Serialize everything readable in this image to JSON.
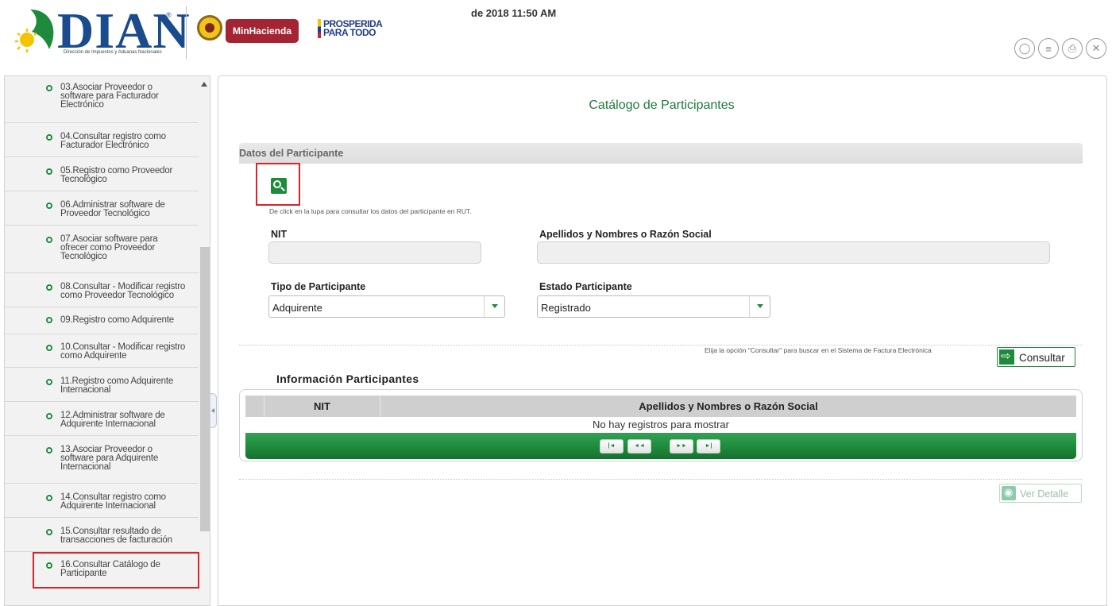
{
  "header": {
    "logo_text": "DIAN",
    "logo_registered": "®",
    "logo_subtitle": "Dirección de Impuestos y Aduanas Nacionales",
    "ministry_badge": "MinHacienda",
    "slogan_line1": "PROSPERIDA",
    "slogan_line2": "PARA TODO",
    "datetime": "de 2018 11:50 AM",
    "tool_icons": [
      "shield-icon",
      "list-icon",
      "printer-icon",
      "close-circle-icon"
    ],
    "colors": {
      "brand_blue": "#1a4b8c",
      "ministry_red": "#a42434"
    }
  },
  "sidebar": {
    "items": [
      {
        "label": "03.Asociar Proveedor o\nsoftware para Facturador\nElectrónico"
      },
      {
        "label": "04.Consultar registro como\nFacturador Electrónico"
      },
      {
        "label": "05.Registro como Proveedor\nTecnológico"
      },
      {
        "label": "06.Administrar software de\nProveedor Tecnológico"
      },
      {
        "label": "07.Asociar software para\nofrecer como Proveedor\nTecnológico"
      },
      {
        "label": "08.Consultar - Modificar registro\ncomo Proveedor Tecnológico"
      },
      {
        "label": "09.Registro como Adquirente"
      },
      {
        "label": "10.Consultar - Modificar registro\ncomo Adquirente"
      },
      {
        "label": "11.Registro como Adquirente\nInternacional"
      },
      {
        "label": "12.Administrar software de\nAdquirente Internacional"
      },
      {
        "label": "13.Asociar Proveedor o\nsoftware para Adquirente\nInternacional"
      },
      {
        "label": "14.Consultar registro como\nAdquirente Internacional"
      },
      {
        "label": "15.Consultar resultado de\ntransacciones de facturación"
      },
      {
        "label": "16.Consultar Catálogo de\nParticipante"
      }
    ],
    "selected_item": "16.Consultar Catálogo de Participante"
  },
  "main": {
    "title": "Catálogo de Participantes",
    "section_title": "Datos del Participante",
    "search_hint": "De click en la lupa para consultar los datos del participante en RUT.",
    "fields": {
      "nit_label": "NIT",
      "nit_value": "",
      "name_label": "Apellidos y Nombres o Razón Social",
      "name_value": "",
      "tipo_label": "Tipo de Participante",
      "tipo_value": "Adquirente",
      "estado_label": "Estado Participante",
      "estado_value": "Registrado"
    },
    "consult_hint": "Elija la opción \"Consultar\" para buscar en el Sistema de Factura Electrónica",
    "consult_button": "Consultar",
    "results_title": "Información Participantes",
    "grid": {
      "columns": [
        "NIT",
        "Apellidos y Nombres o Razón Social"
      ],
      "rows": [],
      "empty_message": "No hay registros para mostrar",
      "pager": {
        "first": "|◄",
        "prev": "◄◄",
        "next": "►►",
        "last": "►|"
      }
    },
    "detail_button": "Ver Detalle",
    "colors": {
      "accent_green": "#1e8a3b",
      "highlight_red": "#d8242a"
    }
  }
}
